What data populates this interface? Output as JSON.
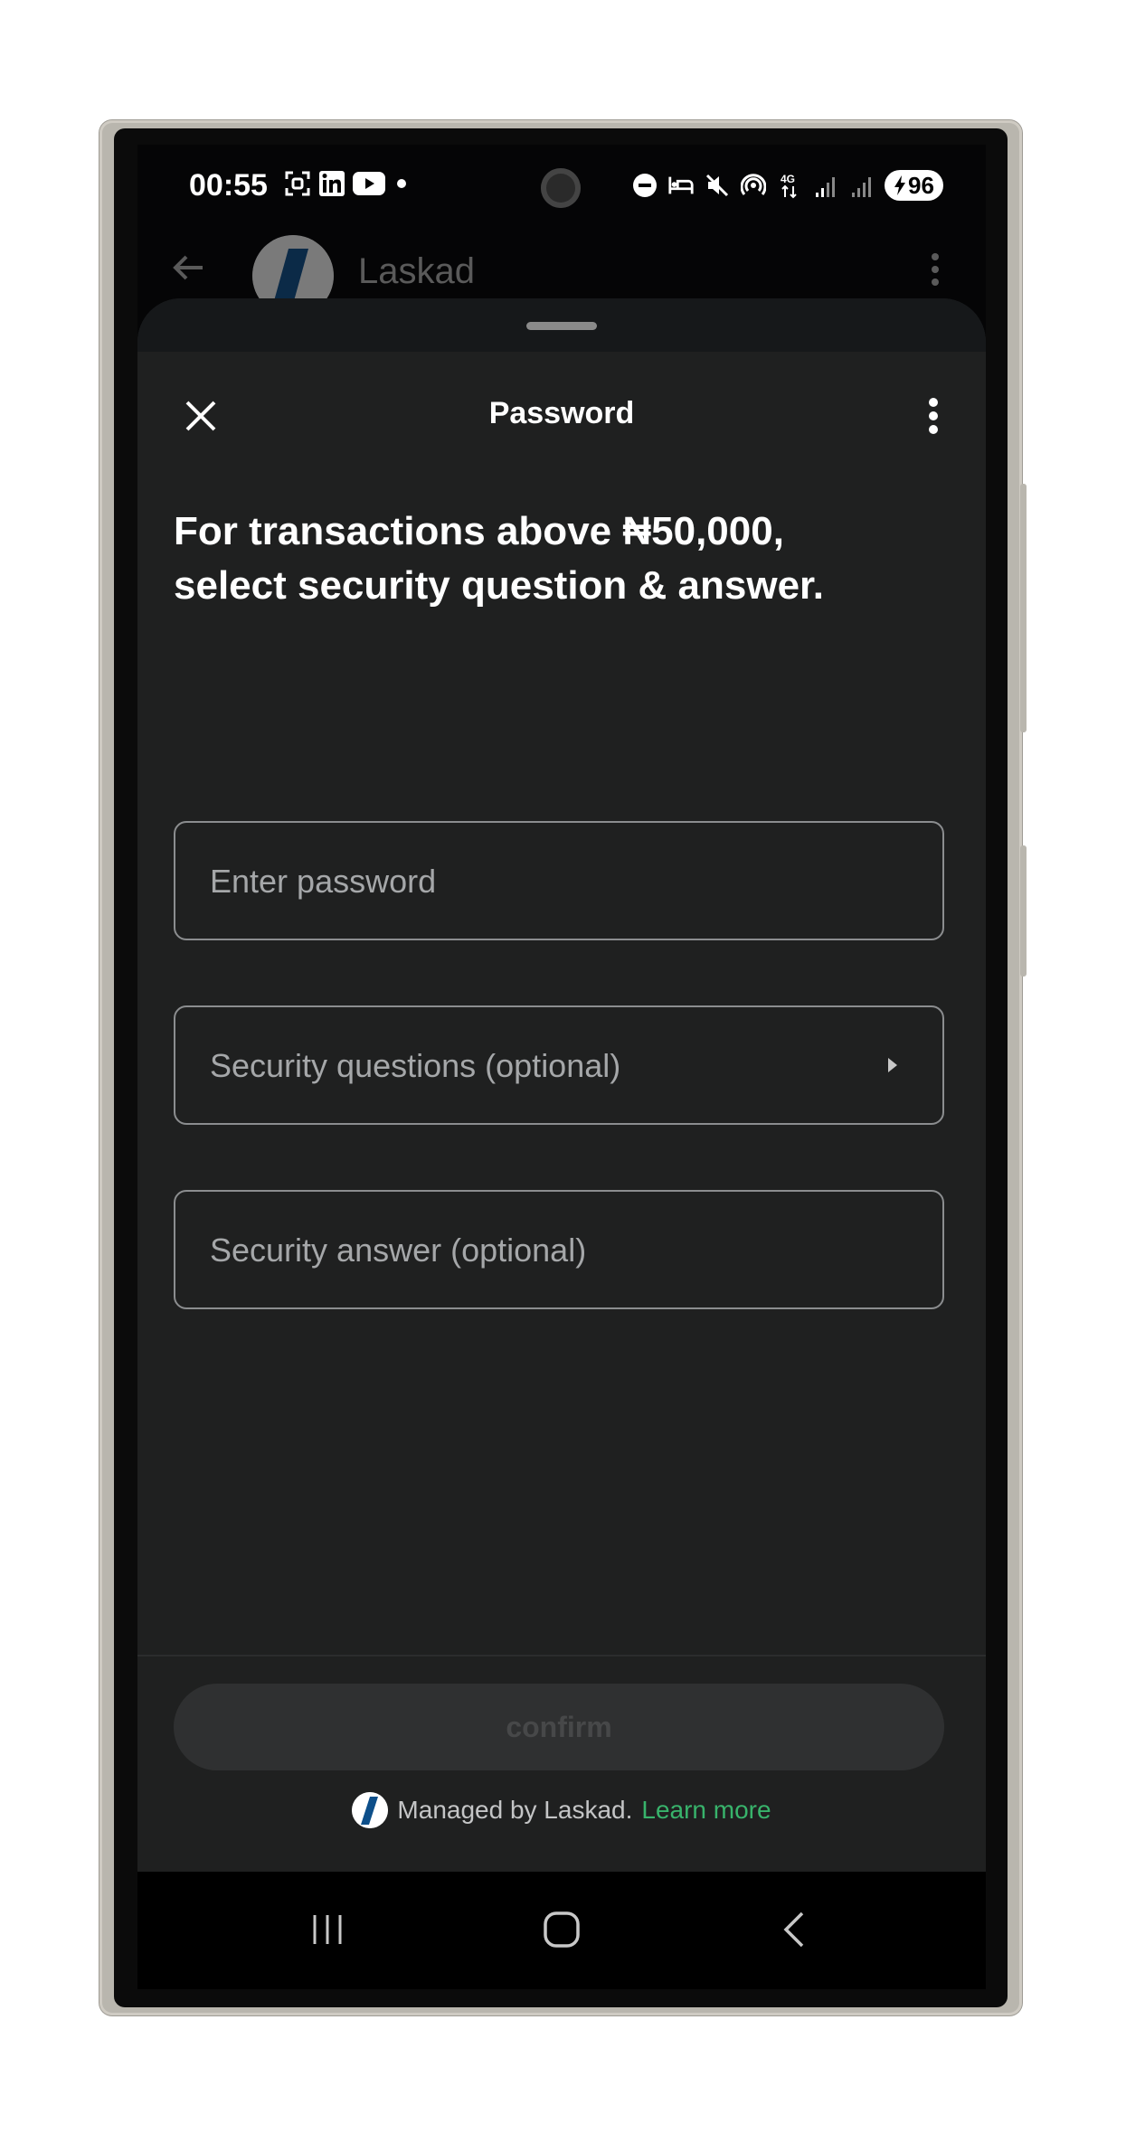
{
  "status_bar": {
    "time": "00:55",
    "left_icons": [
      "screenshot-icon",
      "linkedin-icon",
      "youtube-icon",
      "notification-dot-icon"
    ],
    "right_icons": [
      "do-not-disturb-icon",
      "sleep-mode-icon",
      "mute-icon",
      "hotspot-icon",
      "4g-data-icon",
      "signal-icon",
      "signal-icon"
    ],
    "battery": "96"
  },
  "background_app": {
    "title": "Laskad"
  },
  "sheet": {
    "title": "Password",
    "heading_line1": "For transactions above ₦50,000,",
    "heading_line2": "select security question & answer.",
    "password_placeholder": "Enter password",
    "security_question_label": "Security questions (optional)",
    "security_answer_placeholder": "Security answer (optional)",
    "confirm_label": "confirm",
    "managed_text": "Managed by Laskad.",
    "learn_more": "Learn more"
  },
  "colors": {
    "sheet_bg": "#1f2020",
    "accent_link": "#38b36b",
    "brand_blue": "#0d4f8a"
  },
  "navigation": {
    "buttons": [
      "recents-icon",
      "home-icon",
      "back-icon"
    ]
  }
}
